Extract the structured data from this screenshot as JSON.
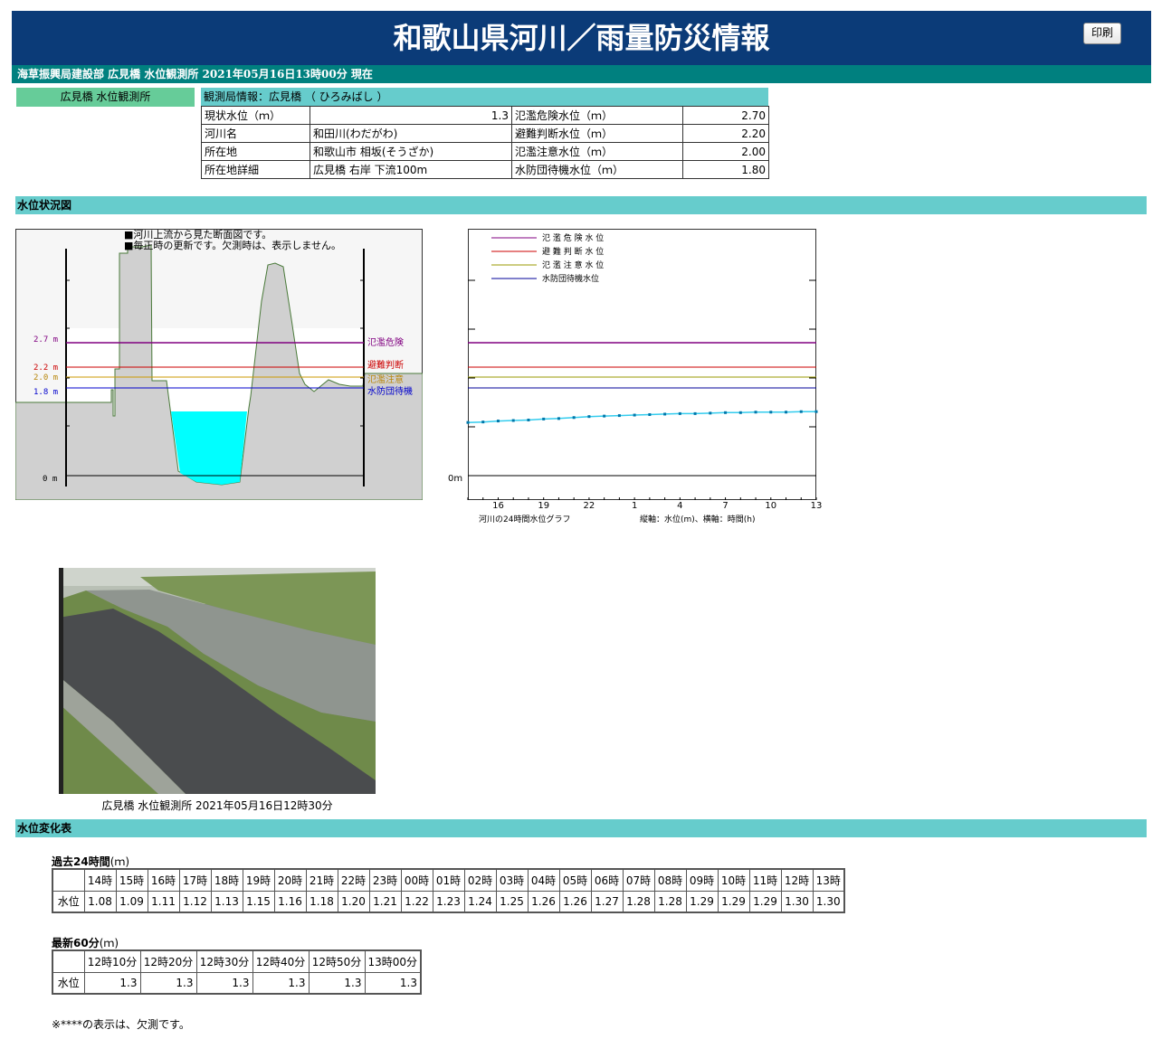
{
  "header": {
    "title": "和歌山県河川／雨量防災情報",
    "print_label": "印刷"
  },
  "subbar": {
    "text": "海草振興局建設部 広見橋 水位観測所 2021年05月16日13時00分 現在"
  },
  "station_tab": "広見橋 水位観測所",
  "info": {
    "heading": "観測局情報：広見橋 （ ひろみばし ）",
    "rows": [
      {
        "label": "現状水位（ｍ）",
        "value": "1.3",
        "label2": "氾濫危険水位（ｍ）",
        "value2": "2.70"
      },
      {
        "label": "河川名",
        "value": "和田川(わだがわ)",
        "label2": "避難判断水位（ｍ）",
        "value2": "2.20"
      },
      {
        "label": "所在地",
        "value": "和歌山市 相坂(そうざか)",
        "label2": "氾濫注意水位（ｍ）",
        "value2": "2.00"
      },
      {
        "label": "所在地詳細",
        "value": "広見橋 右岸 下流100m",
        "label2": "水防団待機水位（ｍ）",
        "value2": "1.80"
      }
    ]
  },
  "section_status": "水位状況図",
  "cross_section": {
    "notes": [
      "■河川上流から見た断面図です。",
      "■毎正時の更新です。欠測時は、表示しません。"
    ],
    "levels": [
      {
        "label": "2.7 m",
        "name": "氾濫危険",
        "color": "#800080"
      },
      {
        "label": "2.2 m",
        "name": "避難判断",
        "color": "#cc0000"
      },
      {
        "label": "2.0 m",
        "name": "氾濫注意",
        "color": "#b8860b"
      },
      {
        "label": "1.8 m",
        "name": "水防団待機",
        "color": "#0000cc"
      }
    ],
    "zero_label": "0 m"
  },
  "chart_data": {
    "type": "line",
    "legend": [
      {
        "name": "氾 濫 危 険 水 位",
        "color": "#800080"
      },
      {
        "name": "避 難 判 断 水 位",
        "color": "#cc0000"
      },
      {
        "name": "氾 濫 注 意 水 位",
        "color": "#999900"
      },
      {
        "name": "水防団待機水位",
        "color": "#000099"
      }
    ],
    "x_ticks": [
      "16",
      "19",
      "22",
      "1",
      "4",
      "7",
      "10",
      "13"
    ],
    "x": [
      "14",
      "15",
      "16",
      "17",
      "18",
      "19",
      "20",
      "21",
      "22",
      "23",
      "0",
      "1",
      "2",
      "3",
      "4",
      "5",
      "6",
      "7",
      "8",
      "9",
      "10",
      "11",
      "12",
      "13"
    ],
    "series": [
      {
        "values": [
          1.08,
          1.09,
          1.11,
          1.12,
          1.13,
          1.15,
          1.16,
          1.18,
          1.2,
          1.21,
          1.22,
          1.23,
          1.24,
          1.25,
          1.26,
          1.26,
          1.27,
          1.28,
          1.28,
          1.29,
          1.29,
          1.29,
          1.3,
          1.3
        ],
        "color": "#33ccee"
      }
    ],
    "thresholds": [
      2.7,
      2.2,
      2.0,
      1.8
    ],
    "ylim": [
      0,
      5
    ],
    "y_zero_label": "0m",
    "caption_left": "河川の24時間水位グラフ",
    "caption_right": "縦軸：水位(m)、横軸：時間(h)"
  },
  "camera": {
    "caption": "広見橋 水位観測所 2021年05月16日12時30分"
  },
  "section_change": "水位変化表",
  "past24": {
    "title": "過去24時間",
    "unit": "(ｍ)",
    "row_label": "水位",
    "headers": [
      "14時",
      "15時",
      "16時",
      "17時",
      "18時",
      "19時",
      "20時",
      "21時",
      "22時",
      "23時",
      "00時",
      "01時",
      "02時",
      "03時",
      "04時",
      "05時",
      "06時",
      "07時",
      "08時",
      "09時",
      "10時",
      "11時",
      "12時",
      "13時"
    ],
    "values": [
      "1.08",
      "1.09",
      "1.11",
      "1.12",
      "1.13",
      "1.15",
      "1.16",
      "1.18",
      "1.20",
      "1.21",
      "1.22",
      "1.23",
      "1.24",
      "1.25",
      "1.26",
      "1.26",
      "1.27",
      "1.28",
      "1.28",
      "1.29",
      "1.29",
      "1.29",
      "1.30",
      "1.30"
    ]
  },
  "latest60": {
    "title": "最新60分",
    "unit": "(ｍ)",
    "row_label": "水位",
    "headers": [
      "12時10分",
      "12時20分",
      "12時30分",
      "12時40分",
      "12時50分",
      "13時00分"
    ],
    "values": [
      "1.3",
      "1.3",
      "1.3",
      "1.3",
      "1.3",
      "1.3"
    ]
  },
  "footnote": "※****の表示は、欠測です。"
}
